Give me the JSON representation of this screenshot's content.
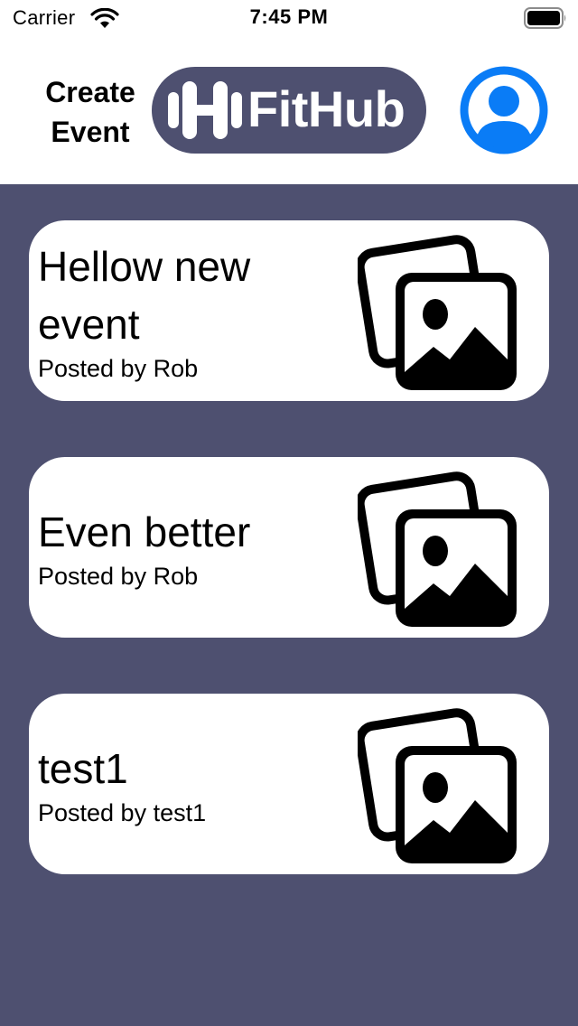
{
  "status_bar": {
    "carrier": "Carrier",
    "time": "7:45 PM",
    "wifi_icon": "wifi-icon",
    "battery_icon": "battery-icon"
  },
  "header": {
    "create_event_label": "Create Event",
    "logo_text": "FitHub",
    "logo_icon": "dumbbell-icon",
    "profile_icon": "person-circle-icon",
    "logo_bg": "#4e5070",
    "accent": "#0a7cf6"
  },
  "theme": {
    "content_bg": "#4e5070",
    "card_bg": "#ffffff"
  },
  "events": [
    {
      "title": "Hellow new event",
      "author": "Posted by Rob",
      "icon": "photos-icon"
    },
    {
      "title": "Even better",
      "author": "Posted by Rob",
      "icon": "photos-icon"
    },
    {
      "title": "test1",
      "author": "Posted by test1",
      "icon": "photos-icon"
    }
  ]
}
